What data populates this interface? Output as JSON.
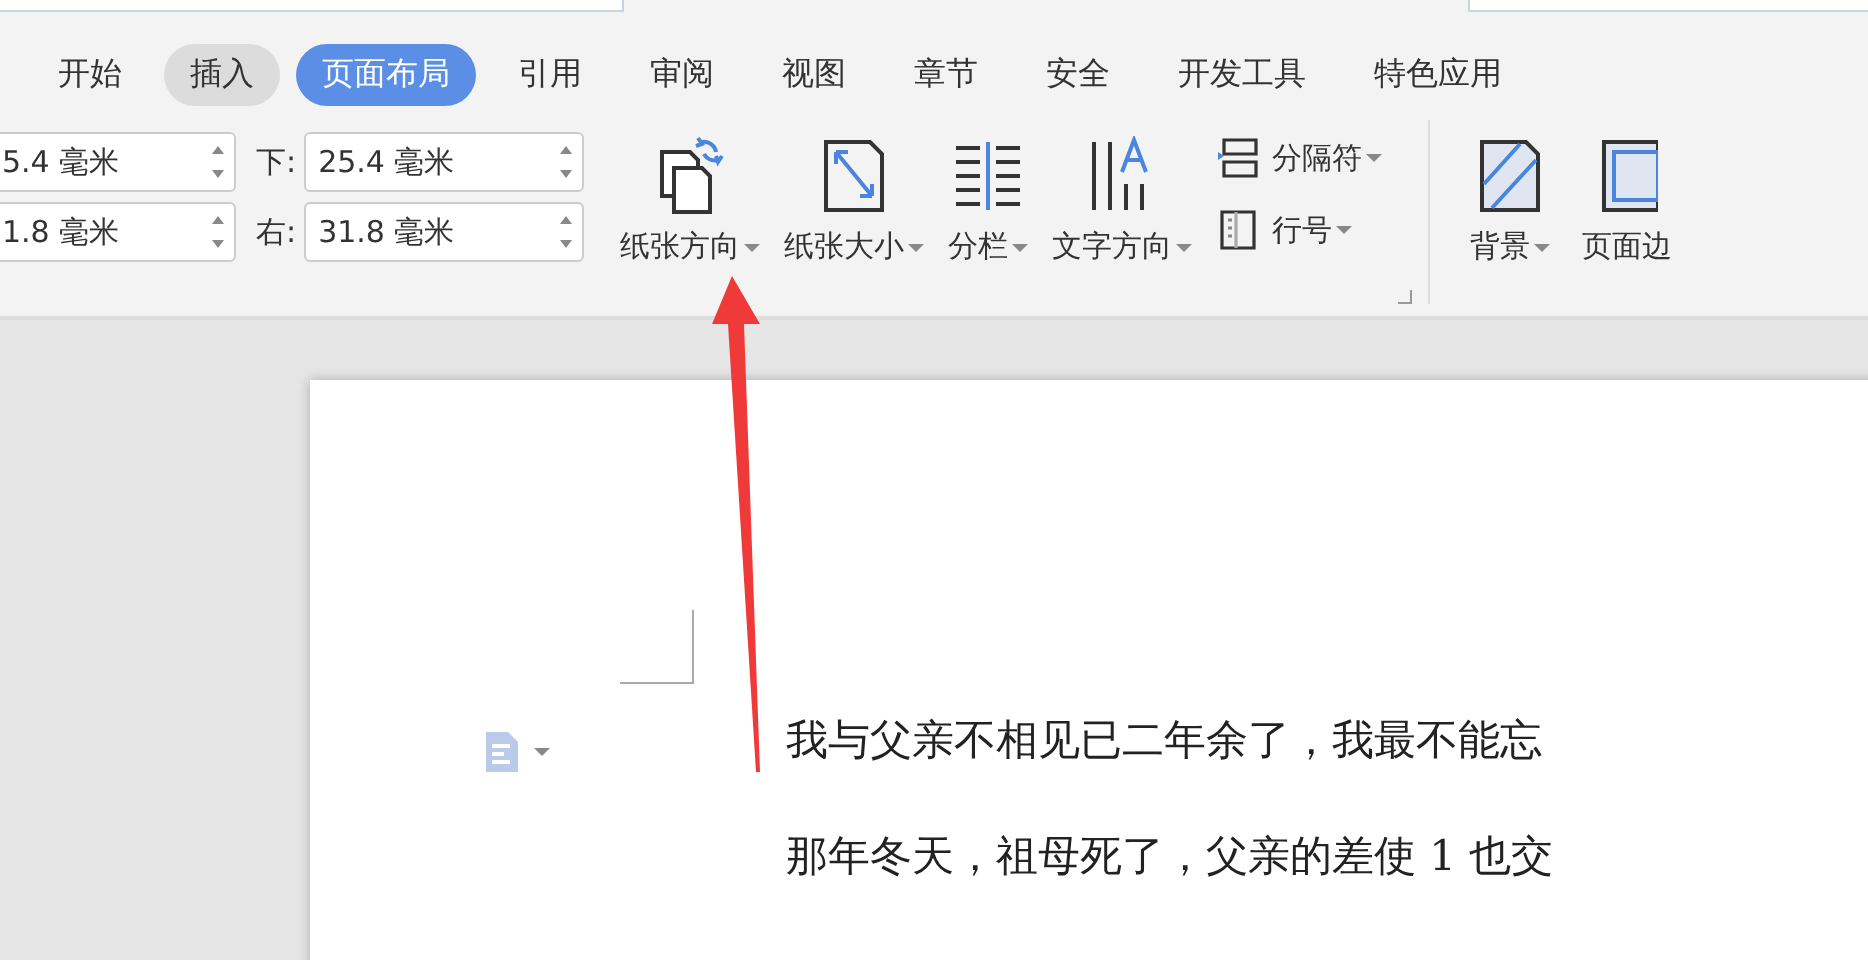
{
  "tabs": [
    {
      "label": "开始",
      "selected": false,
      "hovered": false
    },
    {
      "label": "插入",
      "selected": false,
      "hovered": true
    },
    {
      "label": "页面布局",
      "selected": true,
      "hovered": false
    },
    {
      "label": "引用",
      "selected": false,
      "hovered": false
    },
    {
      "label": "审阅",
      "selected": false,
      "hovered": false
    },
    {
      "label": "视图",
      "selected": false,
      "hovered": false
    },
    {
      "label": "章节",
      "selected": false,
      "hovered": false
    },
    {
      "label": "安全",
      "selected": false,
      "hovered": false
    },
    {
      "label": "开发工具",
      "selected": false,
      "hovered": false
    },
    {
      "label": "特色应用",
      "selected": false,
      "hovered": false
    }
  ],
  "margin_rows": [
    {
      "left_value": "5.4 毫米",
      "label": "下:",
      "value": "25.4 毫米"
    },
    {
      "left_value": "1.8 毫米",
      "label": "右:",
      "value": "31.8 毫米"
    }
  ],
  "large_buttons": [
    {
      "label": "纸张方向"
    },
    {
      "label": "纸张大小"
    },
    {
      "label": "分栏"
    },
    {
      "label": "文字方向"
    }
  ],
  "small_buttons": [
    {
      "label": "分隔符"
    },
    {
      "label": "行号"
    }
  ],
  "background_buttons": [
    {
      "label": "背景",
      "has_menu": true
    },
    {
      "label": "页面边",
      "has_menu": false
    }
  ],
  "document": {
    "paragraphs": [
      "我与父亲不相见已二年余了，我最不能忘",
      "那年冬天，祖母死了，父亲的差使 1 也交"
    ]
  }
}
